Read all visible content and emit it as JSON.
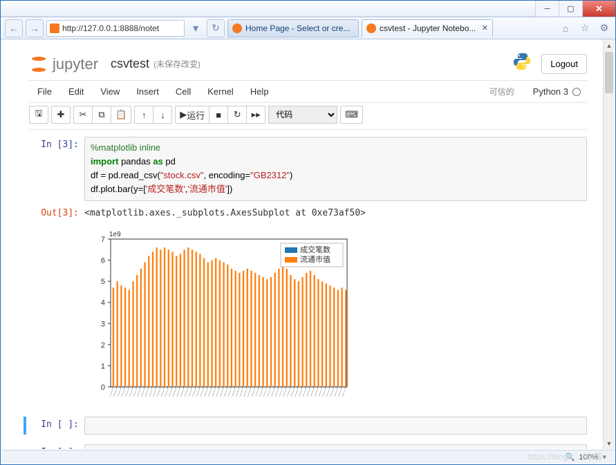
{
  "browser": {
    "url": "http://127.0.0.1:8888/notet",
    "tab1": "Home Page - Select or cre...",
    "tab2": "csvtest - Jupyter Notebo...",
    "zoom": "100%"
  },
  "header": {
    "brand": "jupyter",
    "nb_name": "csvtest",
    "autosave": "(未保存改变)",
    "logout": "Logout",
    "kernel": "Python 3",
    "trusted": "可信的"
  },
  "menus": {
    "file": "File",
    "edit": "Edit",
    "view": "View",
    "insert": "Insert",
    "cell": "Cell",
    "kernel": "Kernel",
    "help": "Help"
  },
  "toolbar": {
    "run": "运行",
    "celltype": "代码"
  },
  "cell_in3_prompt": "In [3]:",
  "cell_out3_prompt": "Out[3]:",
  "cell_empty_prompt": "In [ ]:",
  "code": {
    "l1_magic": "%matplotlib inline",
    "l2_a": "import",
    "l2_b": " pandas ",
    "l2_c": "as",
    "l2_d": " pd",
    "l3_a": "df = pd.read_csv(",
    "l3_b": "\"stock.csv\"",
    "l3_c": ", encoding=",
    "l3_d": "\"GB2312\"",
    "l3_e": ")",
    "l4_a": "df.plot.bar(y=[",
    "l4_b": "'成交笔数'",
    "l4_c": ",",
    "l4_d": "'流通市值'",
    "l4_e": "])"
  },
  "output_repr": "<matplotlib.axes._subplots.AxesSubplot at 0xe73af50>",
  "legend": {
    "a": "成交笔数",
    "b": "流通市值"
  },
  "chart_data": {
    "type": "bar",
    "title": "",
    "xlabel": "",
    "ylabel": "",
    "y_scale_label": "1e9",
    "ylim": [
      0,
      7
    ],
    "yticks": [
      0,
      1,
      2,
      3,
      4,
      5,
      6,
      7
    ],
    "x_index": [
      0,
      1,
      2,
      3,
      4,
      5,
      6,
      7,
      8,
      9,
      10,
      11,
      12,
      13,
      14,
      15,
      16,
      17,
      18,
      19,
      20,
      21,
      22,
      23,
      24,
      25,
      26,
      27,
      28,
      29,
      30,
      31,
      32,
      33,
      34,
      35,
      36,
      37,
      38,
      39,
      40,
      41,
      42,
      43,
      44,
      45,
      46,
      47,
      48,
      49,
      50,
      51,
      52,
      53,
      54,
      55,
      56,
      57,
      58,
      59
    ],
    "series": [
      {
        "name": "成交笔数",
        "color": "#1f77b4",
        "values": [
          0.03,
          0.03,
          0.03,
          0.03,
          0.03,
          0.03,
          0.03,
          0.03,
          0.03,
          0.03,
          0.03,
          0.03,
          0.03,
          0.03,
          0.03,
          0.03,
          0.03,
          0.03,
          0.03,
          0.03,
          0.03,
          0.03,
          0.03,
          0.03,
          0.03,
          0.03,
          0.03,
          0.03,
          0.03,
          0.03,
          0.03,
          0.03,
          0.03,
          0.03,
          0.03,
          0.03,
          0.03,
          0.03,
          0.03,
          0.03,
          0.03,
          0.03,
          0.03,
          0.03,
          0.03,
          0.03,
          0.03,
          0.03,
          0.03,
          0.03,
          0.03,
          0.03,
          0.03,
          0.03,
          0.03,
          0.03,
          0.03,
          0.03,
          0.03,
          0.03
        ]
      },
      {
        "name": "流通市值",
        "color": "#ff7f0e",
        "values": [
          4.7,
          5.0,
          4.8,
          4.7,
          4.6,
          5.0,
          5.3,
          5.6,
          5.9,
          6.2,
          6.4,
          6.6,
          6.5,
          6.6,
          6.5,
          6.4,
          6.2,
          6.3,
          6.5,
          6.6,
          6.5,
          6.4,
          6.3,
          6.1,
          5.9,
          6.0,
          6.1,
          6.0,
          5.9,
          5.8,
          5.6,
          5.5,
          5.4,
          5.5,
          5.6,
          5.5,
          5.4,
          5.3,
          5.2,
          5.1,
          5.2,
          5.4,
          5.6,
          5.7,
          5.6,
          5.3,
          5.1,
          5.0,
          5.2,
          5.4,
          5.5,
          5.3,
          5.1,
          5.0,
          4.9,
          4.8,
          4.7,
          4.6,
          4.7,
          4.6
        ]
      }
    ]
  }
}
